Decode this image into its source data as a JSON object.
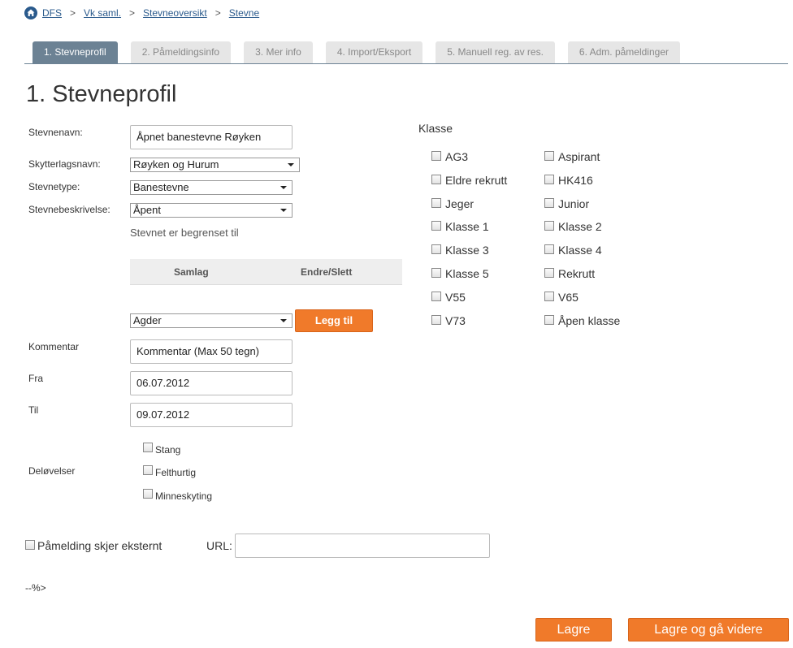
{
  "breadcrumb": {
    "items": [
      "DFS",
      "Vk saml.",
      "Stevneoversikt",
      "Stevne"
    ],
    "separator": ">"
  },
  "tabs": [
    "1. Stevneprofil",
    "2. Påmeldingsinfo",
    "3. Mer info",
    "4. Import/Eksport",
    "5. Manuell reg. av res.",
    "6. Adm. påmeldinger"
  ],
  "page_title": "1. Stevneprofil",
  "form": {
    "stevnenavn_label": "Stevnenavn:",
    "stevnenavn_value": "Åpnet banestevne Røyken",
    "skytterlag_label": "Skytterlagsnavn:",
    "skytterlag_value": "Røyken og Hurum",
    "stevnetype_label": "Stevnetype:",
    "stevnetype_value": "Banestevne",
    "beskrivelse_label": "Stevnebeskrivelse:",
    "beskrivelse_value": "Åpent",
    "begrenset_note": "Stevnet er begrenset til",
    "table_cols": [
      "Samlag",
      "Endre/Slett"
    ],
    "samlag_value": "Agder",
    "legg_til": "Legg til",
    "kommentar_label": "Kommentar",
    "kommentar_value": "Kommentar (Max 50 tegn)",
    "fra_label": "Fra",
    "fra_value": "06.07.2012",
    "til_label": "Til",
    "til_value": "09.07.2012",
    "delovelser_label": "Deløvelser",
    "delovelser": [
      "Stang",
      "Felthurtig",
      "Minneskyting"
    ],
    "ekstern_label": "Påmelding skjer eksternt",
    "url_label": "URL:",
    "url_value": ""
  },
  "klasse": {
    "heading": "Klasse",
    "left": [
      "AG3",
      "Eldre rekrutt",
      "Jeger",
      "Klasse 1",
      "Klasse 3",
      "Klasse 5",
      "V55",
      "V73"
    ],
    "right": [
      "Aspirant",
      "HK416",
      "Junior",
      "Klasse 2",
      "Klasse 4",
      "Rekrutt",
      "V65",
      "Åpen klasse"
    ]
  },
  "stray_text": "--%>",
  "buttons": {
    "save": "Lagre",
    "save_next": "Lagre og gå videre"
  },
  "colors": {
    "accent": "#f07a2a",
    "tab_active": "#6c8294",
    "link": "#2a5a8c"
  }
}
